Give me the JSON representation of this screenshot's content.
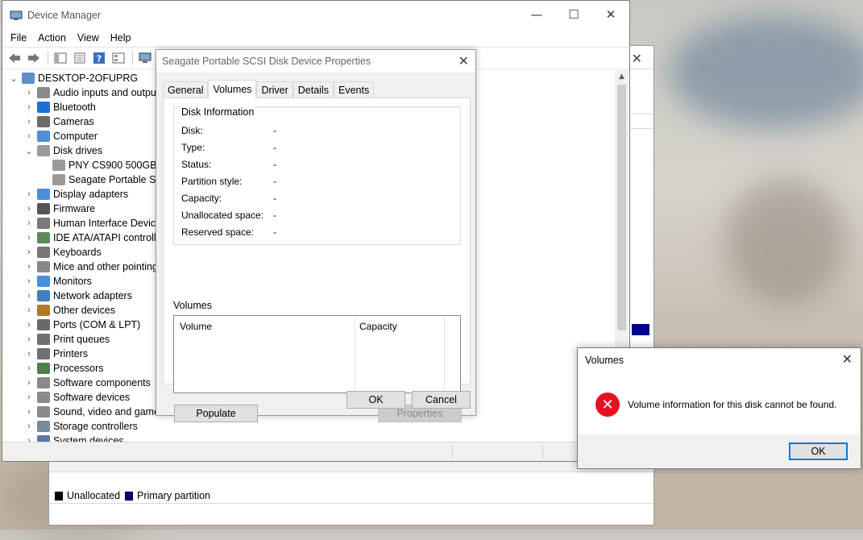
{
  "device_manager": {
    "title": "Device Manager",
    "menu": [
      "File",
      "Action",
      "View",
      "Help"
    ],
    "tree": [
      {
        "label": "DESKTOP-2OFUPRG",
        "level": 0,
        "expanded": true,
        "icon": "computer-icon"
      },
      {
        "label": "Audio inputs and outputs",
        "level": 1,
        "icon": "speaker-icon"
      },
      {
        "label": "Bluetooth",
        "level": 1,
        "icon": "bluetooth-icon"
      },
      {
        "label": "Cameras",
        "level": 1,
        "icon": "camera-icon"
      },
      {
        "label": "Computer",
        "level": 1,
        "icon": "monitor-icon"
      },
      {
        "label": "Disk drives",
        "level": 1,
        "expanded": true,
        "icon": "drive-icon"
      },
      {
        "label": "PNY CS900 500GB SSD",
        "level": 2,
        "icon": "drive-icon"
      },
      {
        "label": "Seagate Portable SCSI Disk Device",
        "level": 2,
        "icon": "drive-icon"
      },
      {
        "label": "Display adapters",
        "level": 1,
        "icon": "monitor-icon"
      },
      {
        "label": "Firmware",
        "level": 1,
        "icon": "chip-icon"
      },
      {
        "label": "Human Interface Devices",
        "level": 1,
        "icon": "hid-icon"
      },
      {
        "label": "IDE ATA/ATAPI controllers",
        "level": 1,
        "icon": "controller-icon"
      },
      {
        "label": "Keyboards",
        "level": 1,
        "icon": "keyboard-icon"
      },
      {
        "label": "Mice and other pointing devices",
        "level": 1,
        "icon": "mouse-icon"
      },
      {
        "label": "Monitors",
        "level": 1,
        "icon": "monitor-icon"
      },
      {
        "label": "Network adapters",
        "level": 1,
        "icon": "network-icon"
      },
      {
        "label": "Other devices",
        "level": 1,
        "icon": "unknown-device-icon"
      },
      {
        "label": "Ports (COM & LPT)",
        "level": 1,
        "icon": "port-icon"
      },
      {
        "label": "Print queues",
        "level": 1,
        "icon": "printer-icon"
      },
      {
        "label": "Printers",
        "level": 1,
        "icon": "printer-icon"
      },
      {
        "label": "Processors",
        "level": 1,
        "icon": "processor-icon"
      },
      {
        "label": "Software components",
        "level": 1,
        "icon": "software-icon"
      },
      {
        "label": "Software devices",
        "level": 1,
        "icon": "software-icon"
      },
      {
        "label": "Sound, video and game controllers",
        "level": 1,
        "icon": "speaker-icon"
      },
      {
        "label": "Storage controllers",
        "level": 1,
        "icon": "storage-icon"
      },
      {
        "label": "System devices",
        "level": 1,
        "icon": "system-icon"
      }
    ]
  },
  "disk_management": {
    "legend": [
      {
        "label": "Unallocated",
        "color": "#000000"
      },
      {
        "label": "Primary partition",
        "color": "#00008b"
      }
    ]
  },
  "properties": {
    "title": "Seagate Portable SCSI Disk Device Properties",
    "tabs": [
      "General",
      "Volumes",
      "Driver",
      "Details",
      "Events"
    ],
    "active_tab": "Volumes",
    "disk_info_label": "Disk Information",
    "rows": [
      {
        "label": "Disk:",
        "value": "-"
      },
      {
        "label": "Type:",
        "value": "-"
      },
      {
        "label": "Status:",
        "value": "-"
      },
      {
        "label": "Partition style:",
        "value": "-"
      },
      {
        "label": "Capacity:",
        "value": "-"
      },
      {
        "label": "Unallocated space:",
        "value": "-"
      },
      {
        "label": "Reserved space:",
        "value": "-"
      }
    ],
    "volumes_label": "Volumes",
    "columns": [
      "Volume",
      "Capacity"
    ],
    "populate_label": "Populate",
    "properties_label": "Properties",
    "ok_label": "OK",
    "cancel_label": "Cancel"
  },
  "msgbox": {
    "title": "Volumes",
    "message": "Volume information for this disk cannot be found.",
    "ok_label": "OK"
  }
}
